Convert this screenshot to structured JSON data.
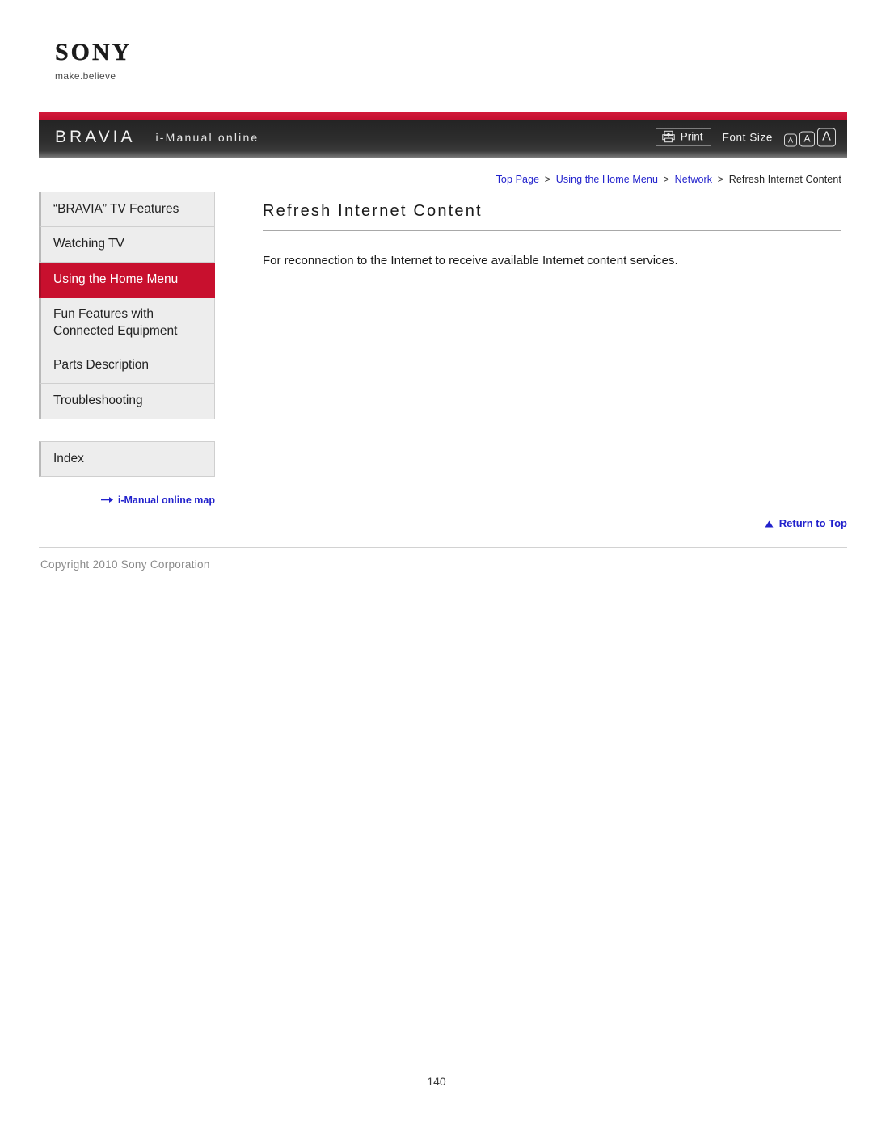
{
  "brand": {
    "wordmark": "SONY",
    "tagline": "make.believe"
  },
  "header": {
    "product": "BRAVIA",
    "title": "i-Manual online",
    "print_label": "Print",
    "print_icon": "printer-icon",
    "font_size_label": "Font Size",
    "font_size_options": [
      "A",
      "A",
      "A"
    ],
    "accent_red": "#c8102e",
    "bar_dark": "#2b2b2b"
  },
  "sidebar": {
    "items": [
      {
        "label": "“BRAVIA” TV Features",
        "active": false
      },
      {
        "label": "Watching TV",
        "active": false
      },
      {
        "label": "Using the Home Menu",
        "active": true
      },
      {
        "label": "Fun Features with Connected Equipment",
        "active": false
      },
      {
        "label": "Parts Description",
        "active": false
      },
      {
        "label": "Troubleshooting",
        "active": false
      }
    ],
    "index_label": "Index",
    "map_link": "i-Manual online map",
    "map_icon": "arrow-right-icon",
    "link_color": "#2222cc"
  },
  "breadcrumb": {
    "items": [
      {
        "label": "Top Page",
        "link": true
      },
      {
        "label": "Using the Home Menu",
        "link": true
      },
      {
        "label": "Network",
        "link": true
      },
      {
        "label": "Refresh Internet Content",
        "link": false
      }
    ],
    "separator": ">"
  },
  "main": {
    "title": "Refresh Internet Content",
    "body": "For reconnection to the Internet to receive available Internet content services."
  },
  "footer": {
    "return_to_top": "Return to Top",
    "return_icon": "triangle-up-icon",
    "copyright": "Copyright 2010 Sony Corporation",
    "page_number": "140"
  }
}
